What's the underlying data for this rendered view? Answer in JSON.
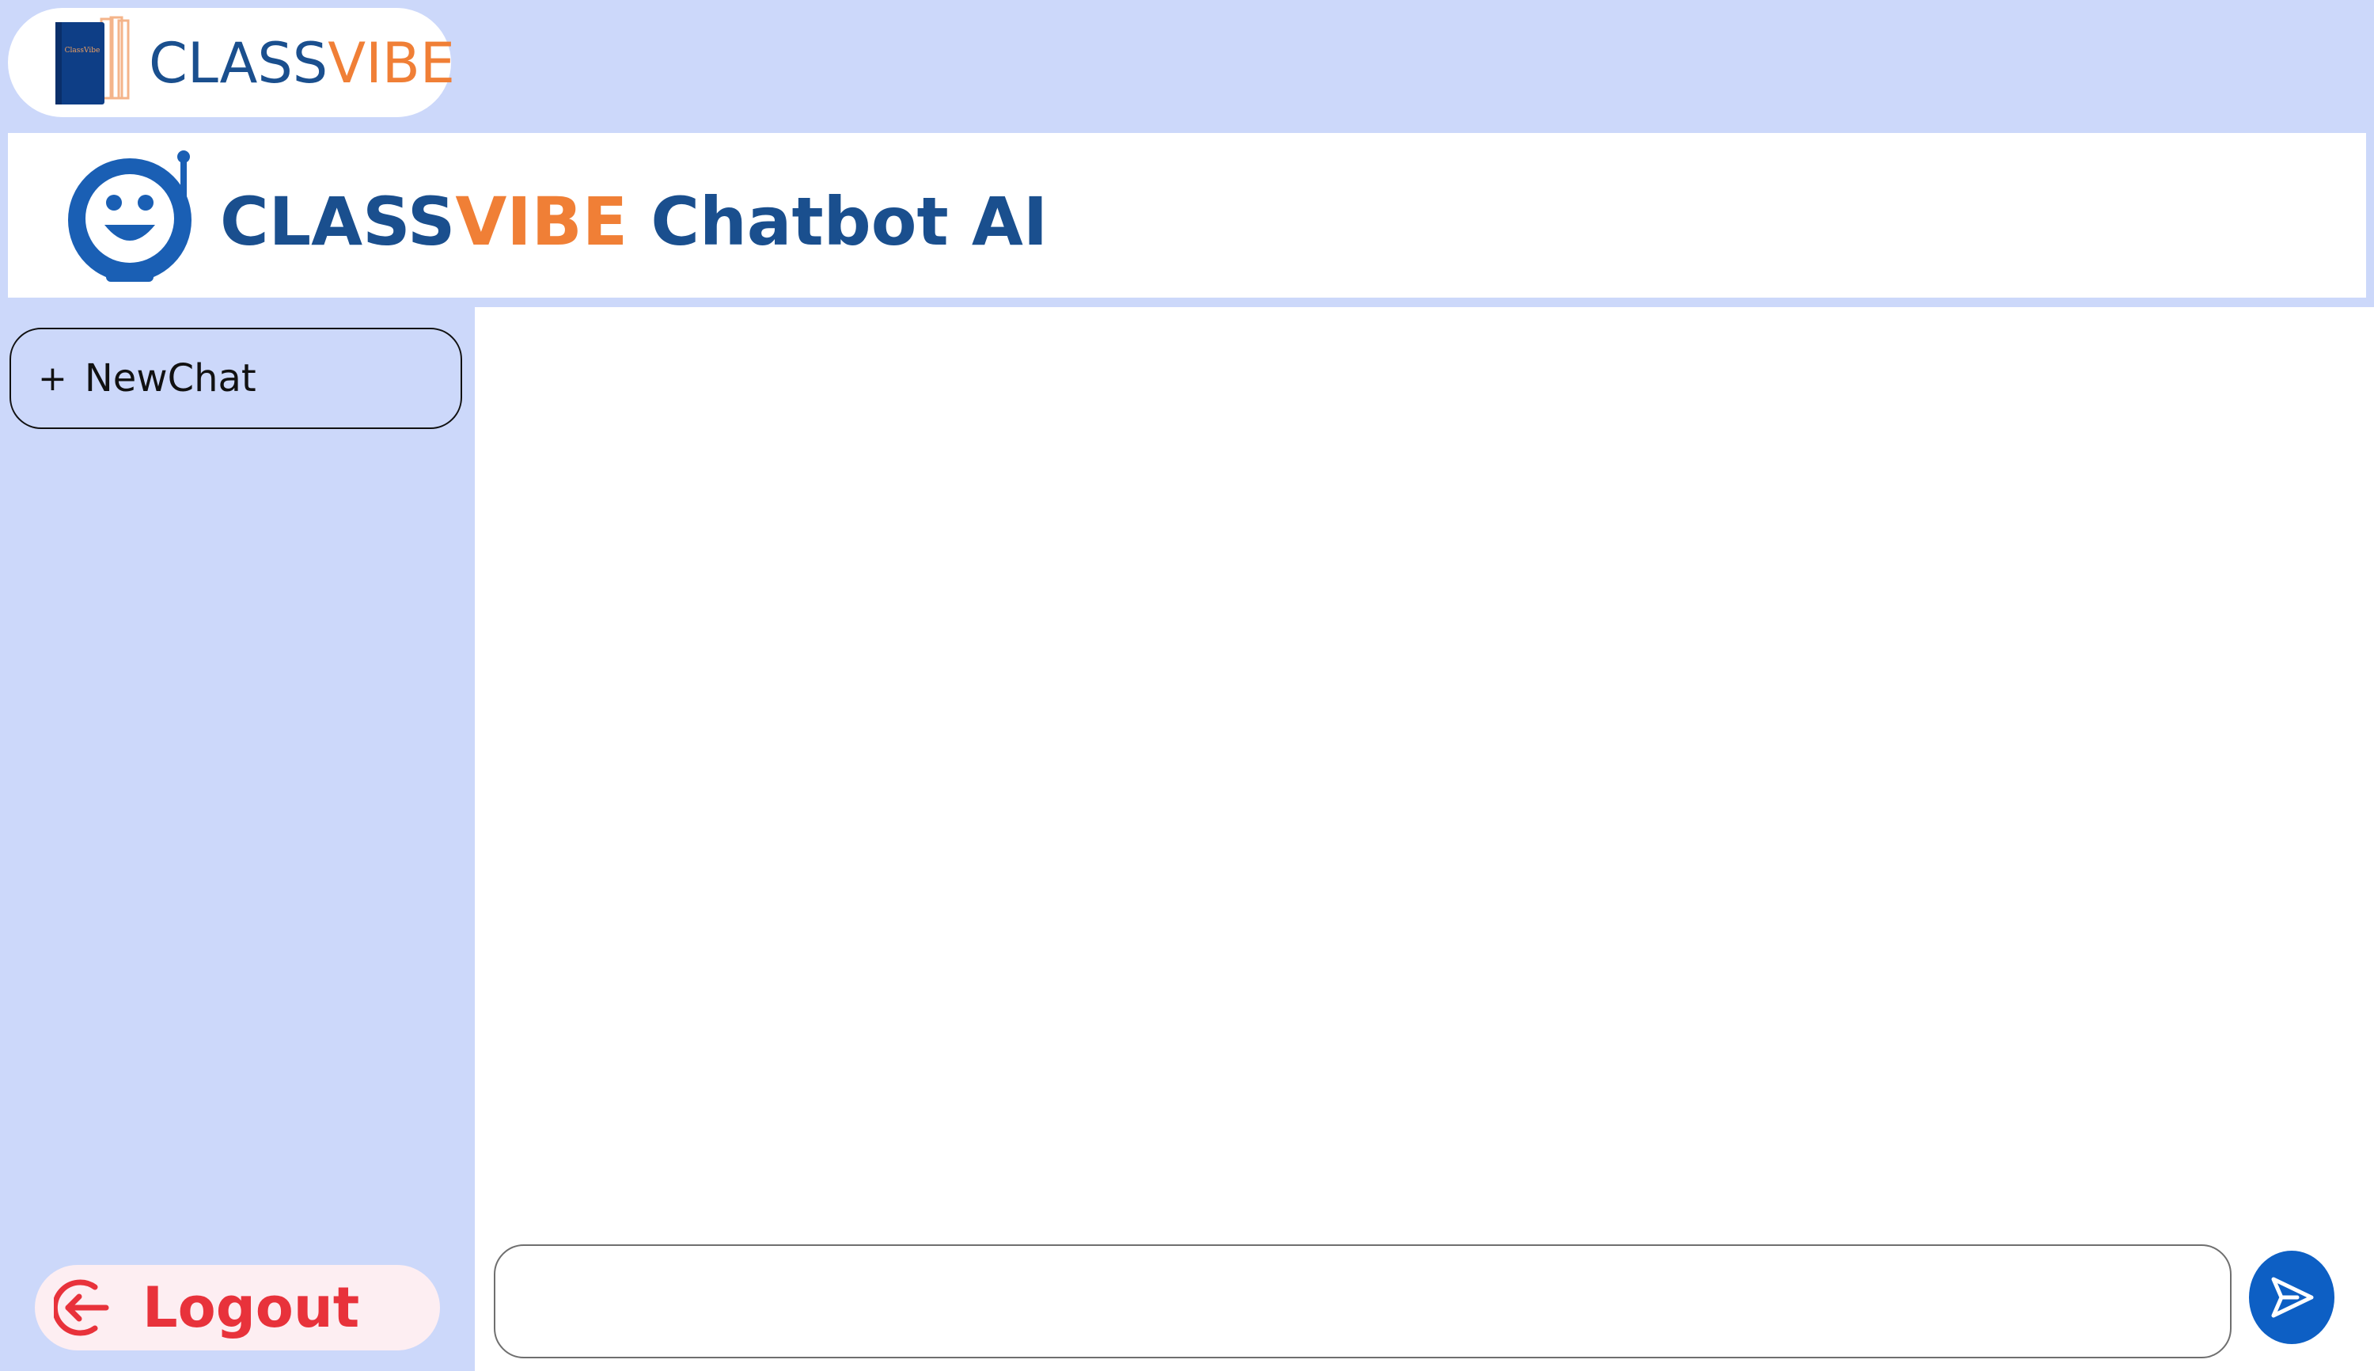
{
  "brand": {
    "logo_book_text": "ClassVibe",
    "name_part1": "CLASS",
    "name_part2": "VIBE"
  },
  "header": {
    "title_part1": "CLASS",
    "title_part2": "VIBE",
    "title_part3": " Chatbot AI"
  },
  "sidebar": {
    "new_chat_icon": "+",
    "new_chat_label": "NewChat",
    "logout_label": "Logout",
    "logout_icon": "logout-icon"
  },
  "chat": {
    "input_value": "",
    "send_icon": "send-icon"
  },
  "colors": {
    "background": "#ccd8fa",
    "brand_blue": "#1a4f8e",
    "brand_orange": "#f07f36",
    "logout_red": "#e8323b",
    "send_blue": "#0d5fc4"
  }
}
